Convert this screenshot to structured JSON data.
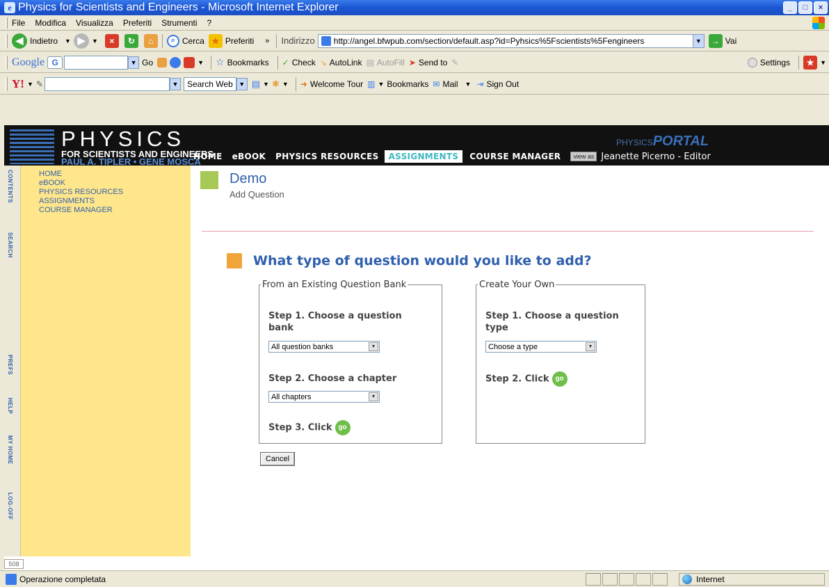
{
  "window": {
    "title": "Physics for Scientists and Engineers - Microsoft Internet Explorer"
  },
  "menu": {
    "items": [
      "File",
      "Modifica",
      "Visualizza",
      "Preferiti",
      "Strumenti",
      "?"
    ]
  },
  "navbar": {
    "back": "Indietro",
    "search": "Cerca",
    "favorites": "Preferiti",
    "address_label": "Indirizzo",
    "url": "http://angel.bfwpub.com/section/default.asp?id=Pyhsics%5Fscientists%5Fengineers",
    "go": "Vai"
  },
  "google_bar": {
    "brand": "Google",
    "go": "Go",
    "bookmarks": "Bookmarks",
    "check": "Check",
    "autolink": "AutoLink",
    "autofill": "AutoFill",
    "send_to": "Send to",
    "settings": "Settings"
  },
  "yahoo_bar": {
    "search_web": "Search Web",
    "welcome_tour": "Welcome Tour",
    "bookmarks": "Bookmarks",
    "mail": "Mail",
    "sign_out": "Sign Out"
  },
  "site": {
    "title": "PHYSICS",
    "subtitle": "FOR SCIENTISTS AND ENGINEERS",
    "authors": "PAUL A. TIPLER • GENE MOSCA",
    "portal_small": "PHYSICS",
    "portal_big": "PORTAL",
    "nav": [
      "HOME",
      "eBOOK",
      "PHYSICS RESOURCES",
      "ASSIGNMENTS",
      "COURSE MANAGER"
    ],
    "view_as": "view as",
    "user": "Jeanette Picerno - Editor"
  },
  "sidebar": {
    "tabs": [
      "CONTENTS",
      "SEARCH",
      "PREFS",
      "HELP",
      "MY HOME",
      "LOG-OFF"
    ],
    "links": [
      "HOME",
      "eBOOK",
      "PHYSICS RESOURCES",
      "ASSIGNMENTS",
      "COURSE MANAGER"
    ],
    "page_number": "508"
  },
  "main": {
    "title": "Demo",
    "subtitle": "Add Question",
    "question": "What type of question would you like to add?",
    "existing": {
      "legend": "From an Existing Question Bank",
      "step1": "Step 1. Choose a question bank",
      "bank_select": "All question banks",
      "step2": "Step 2. Choose a chapter",
      "chapter_select": "All chapters",
      "step3": "Step 3. Click",
      "go": "go"
    },
    "own": {
      "legend": "Create Your Own",
      "step1": "Step 1. Choose a question type",
      "type_select": "Choose a type",
      "step2": "Step 2. Click",
      "go": "go"
    },
    "cancel": "Cancel"
  },
  "status": {
    "text": "Operazione completata",
    "zone": "Internet"
  }
}
